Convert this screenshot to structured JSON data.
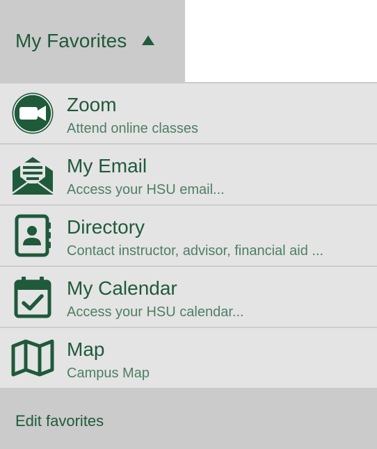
{
  "header": {
    "title": "My Favorites",
    "caret_icon": "caret-up-icon"
  },
  "items": [
    {
      "title": "Zoom",
      "subtitle": "Attend online classes",
      "icon": "video-camera-icon"
    },
    {
      "title": "My Email",
      "subtitle": "Access your HSU email...",
      "icon": "open-envelope-icon"
    },
    {
      "title": "Directory",
      "subtitle": "Contact instructor, advisor, financial aid ...",
      "icon": "contact-book-icon"
    },
    {
      "title": "My Calendar",
      "subtitle": "Access your HSU calendar...",
      "icon": "calendar-check-icon"
    },
    {
      "title": "Map",
      "subtitle": "Campus Map",
      "icon": "folded-map-icon"
    }
  ],
  "footer": {
    "edit_label": "Edit favorites"
  },
  "colors": {
    "accent": "#1f5a3a",
    "subtitle": "#4d7f64",
    "header_bg": "#cbcbcb",
    "item_bg": "#e4e4e4"
  }
}
